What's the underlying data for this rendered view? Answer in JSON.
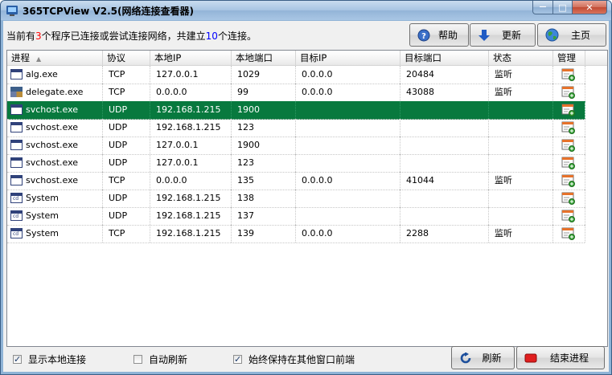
{
  "window": {
    "title_prefix": "365TCPView V2.5",
    "title_suffix": "(网络连接查看器)",
    "controls": {
      "minimize": "—",
      "maximize": "□",
      "close": "✕"
    }
  },
  "status": {
    "part1": "当前有",
    "program_count": "3",
    "part2": "个程序已连接或尝试连接网络，共建立",
    "connection_count": "10",
    "part3": "个连接。"
  },
  "toolbar": {
    "help": "帮助",
    "update": "更新",
    "home": "主页"
  },
  "table": {
    "columns": [
      "进程",
      "协议",
      "本地IP",
      "本地端口",
      "目标IP",
      "目标端口",
      "状态",
      "管理"
    ],
    "sort_indicator": "▲",
    "rows": [
      {
        "icon": "window-icon",
        "process": "alg.exe",
        "protocol": "TCP",
        "local_ip": "127.0.0.1",
        "local_port": "1029",
        "remote_ip": "0.0.0.0",
        "remote_port": "20484",
        "state": "监听"
      },
      {
        "icon": "delegate-icon",
        "process": "delegate.exe",
        "protocol": "TCP",
        "local_ip": "0.0.0.0",
        "local_port": "99",
        "remote_ip": "0.0.0.0",
        "remote_port": "43088",
        "state": "监听"
      },
      {
        "icon": "window-icon",
        "process": "svchost.exe",
        "protocol": "UDP",
        "local_ip": "192.168.1.215",
        "local_port": "1900",
        "remote_ip": "",
        "remote_port": "",
        "state": "",
        "selected": true
      },
      {
        "icon": "window-icon",
        "process": "svchost.exe",
        "protocol": "UDP",
        "local_ip": "192.168.1.215",
        "local_port": "123",
        "remote_ip": "",
        "remote_port": "",
        "state": ""
      },
      {
        "icon": "window-icon",
        "process": "svchost.exe",
        "protocol": "UDP",
        "local_ip": "127.0.0.1",
        "local_port": "1900",
        "remote_ip": "",
        "remote_port": "",
        "state": ""
      },
      {
        "icon": "window-icon",
        "process": "svchost.exe",
        "protocol": "UDP",
        "local_ip": "127.0.0.1",
        "local_port": "123",
        "remote_ip": "",
        "remote_port": "",
        "state": ""
      },
      {
        "icon": "window-icon",
        "process": "svchost.exe",
        "protocol": "TCP",
        "local_ip": "0.0.0.0",
        "local_port": "135",
        "remote_ip": "0.0.0.0",
        "remote_port": "41044",
        "state": "监听"
      },
      {
        "icon": "system-icon",
        "process": "System",
        "protocol": "UDP",
        "local_ip": "192.168.1.215",
        "local_port": "138",
        "remote_ip": "",
        "remote_port": "",
        "state": ""
      },
      {
        "icon": "system-icon",
        "process": "System",
        "protocol": "UDP",
        "local_ip": "192.168.1.215",
        "local_port": "137",
        "remote_ip": "",
        "remote_port": "",
        "state": ""
      },
      {
        "icon": "system-icon",
        "process": "System",
        "protocol": "TCP",
        "local_ip": "192.168.1.215",
        "local_port": "139",
        "remote_ip": "0.0.0.0",
        "remote_port": "2288",
        "state": "监听"
      }
    ]
  },
  "bottom": {
    "show_local": {
      "label": "显示本地连接",
      "checked": true
    },
    "auto_refresh": {
      "label": "自动刷新",
      "checked": false
    },
    "always_on_top": {
      "label": "始终保持在其他窗口前端",
      "checked": true
    },
    "refresh": "刷新",
    "kill_process": "结束进程"
  },
  "colors": {
    "selected_row": "#08793e",
    "program_count": "#ff0000",
    "connection_count": "#0000ff"
  }
}
